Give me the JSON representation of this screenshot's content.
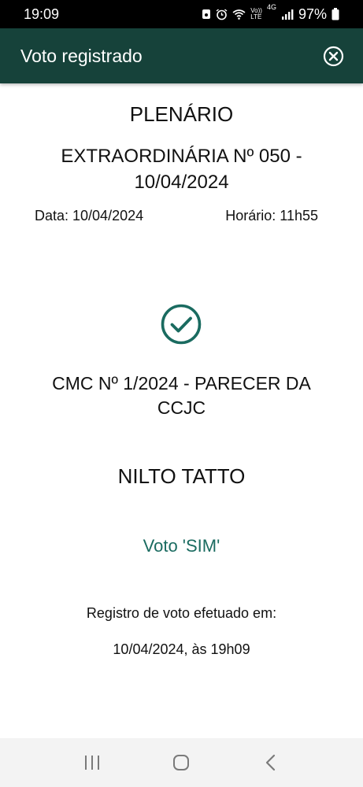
{
  "status_bar": {
    "time": "19:09",
    "battery": "97%",
    "icons": [
      "media-icon",
      "alarm-icon",
      "wifi-icon",
      "volte-icon",
      "4g-icon",
      "signal-icon",
      "battery-icon"
    ],
    "volte_line1": "Vo))",
    "volte_line2": "LTE",
    "network": "4G"
  },
  "app_bar": {
    "title": "Voto registrado",
    "background": "#16423a",
    "close_icon": "close-circle-icon"
  },
  "session": {
    "body": "PLENÁRIO",
    "name": "EXTRAORDINÁRIA Nº 050 - 10/04/2024",
    "date_text": "Data: 10/04/2024",
    "time_text": "Horário: 11h55"
  },
  "result": {
    "icon": "check-circle-icon",
    "accent": "#1a6b60",
    "matter": "CMC Nº 1/2024 - PARECER DA CCJC",
    "voter": "NILTO TATTO",
    "vote": "Voto 'SIM'",
    "registered_label": "Registro de voto efetuado em:",
    "registered_when": "10/04/2024, às 19h09"
  },
  "nav_bar": {
    "icons": [
      "recent-apps-icon",
      "home-icon",
      "back-icon"
    ]
  }
}
